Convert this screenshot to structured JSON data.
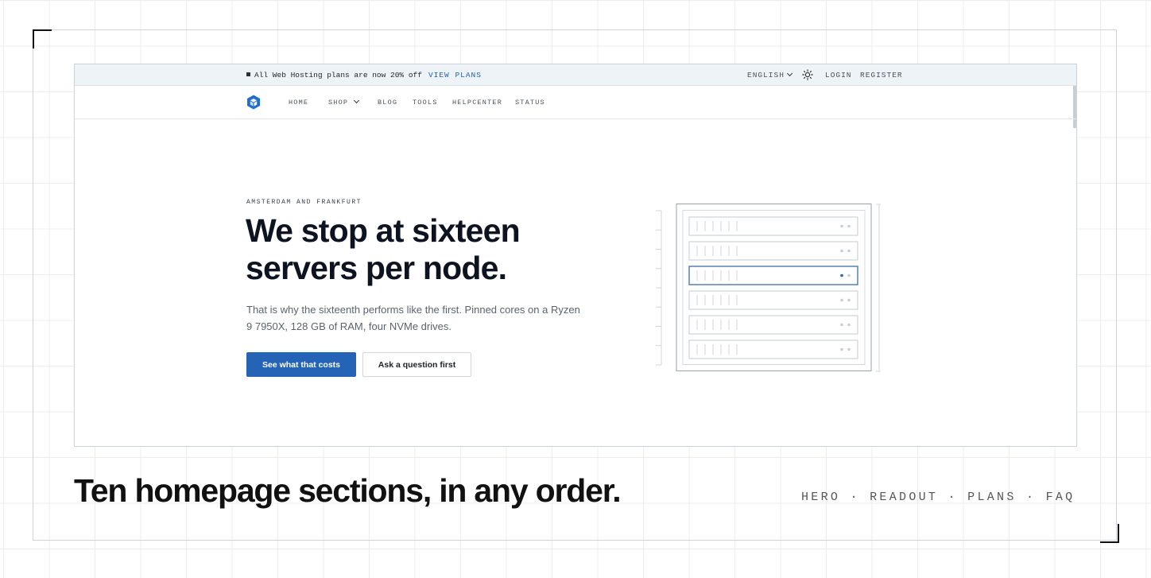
{
  "announcement": {
    "message": "All Web Hosting plans are now 20% off",
    "link": "VIEW PLANS",
    "language": "ENGLISH",
    "login": "LOGIN",
    "register": "REGISTER"
  },
  "nav": {
    "home": "HOME",
    "shop": "SHOP",
    "blog": "BLOG",
    "tools": "TOOLS",
    "helpcenter": "HELPCENTER",
    "status": "STATUS"
  },
  "hero": {
    "eyebrow": "AMSTERDAM AND FRANKFURT",
    "headline": "We stop at sixteen servers per node.",
    "subtext": "That is why the sixteenth performs like the first. Pinned cores on a Ryzen 9 7950X, 128 GB of RAM, four NVMe drives.",
    "primary_button": "See what that costs",
    "secondary_button": "Ask a question first"
  },
  "rack": {
    "slot_count": 6,
    "active_slot": 3
  },
  "footer": {
    "tagline": "Ten homepage sections, in any order.",
    "sections": [
      "HERO",
      "READOUT",
      "PLANS",
      "FAQ"
    ],
    "separator": " · "
  },
  "colors": {
    "accent": "#2463b6",
    "announce_bg": "#eef3f7",
    "heading": "#0d1320"
  }
}
